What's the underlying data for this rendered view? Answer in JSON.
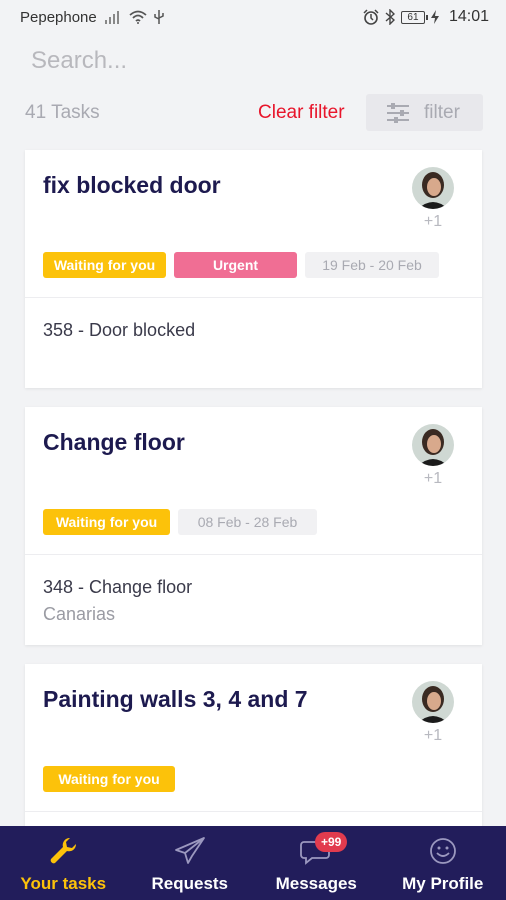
{
  "status_bar": {
    "carrier": "Pepephone",
    "battery": "61",
    "time": "14:01"
  },
  "search": {
    "placeholder": "Search..."
  },
  "filter_row": {
    "task_count": "41 Tasks",
    "clear_filter_label": "Clear filter",
    "filter_label": "filter"
  },
  "tasks": [
    {
      "title": "fix blocked door",
      "extra_assignees": "+1",
      "tags": {
        "waiting": "Waiting for you",
        "urgent": "Urgent",
        "date": "19 Feb - 20 Feb"
      },
      "reference": "358 - Door blocked",
      "location": ""
    },
    {
      "title": "Change floor",
      "extra_assignees": "+1",
      "tags": {
        "waiting": "Waiting for you",
        "date": "08 Feb - 28 Feb"
      },
      "reference": "348 - Change floor",
      "location": "Canarias"
    },
    {
      "title": "Painting walls 3, 4 and 7",
      "extra_assignees": "+1",
      "tags": {
        "waiting": "Waiting for you"
      }
    }
  ],
  "bottom_nav": {
    "items": [
      {
        "label": "Your tasks",
        "icon": "wrench-icon",
        "active": true
      },
      {
        "label": "Requests",
        "icon": "paper-plane-icon"
      },
      {
        "label": "Messages",
        "icon": "chat-bubble-icon",
        "badge": "+99"
      },
      {
        "label": "My Profile",
        "icon": "smiley-icon"
      }
    ]
  },
  "colors": {
    "primary_dark": "#221d5b",
    "accent_yellow": "#fcc20a",
    "urgent_pink": "#f06e94",
    "clear_red": "#e8152b",
    "badge_red": "#e23b4e"
  }
}
